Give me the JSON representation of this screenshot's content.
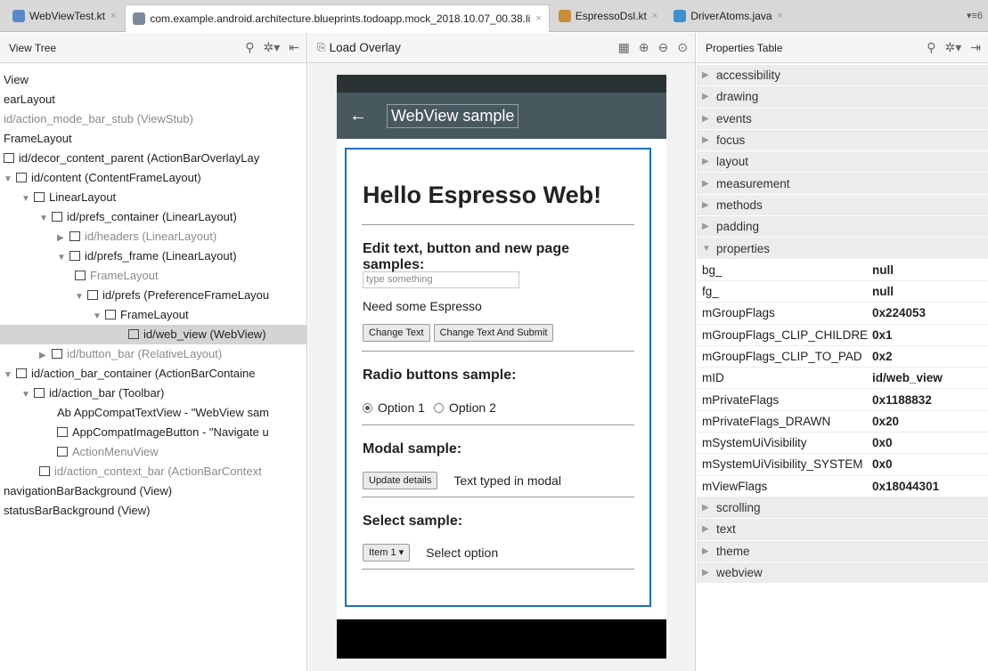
{
  "tabs": [
    {
      "label": "WebViewTest.kt",
      "icon": "kotlin-file-icon",
      "color": "#5b88c9",
      "active": false
    },
    {
      "label": "com.example.android.architecture.blueprints.todoapp.mock_2018.10.07_00.38.li",
      "icon": "layout-inspector-icon",
      "color": "#7c8a99",
      "active": true
    },
    {
      "label": "EspressoDsl.kt",
      "icon": "kotlin-file-icon",
      "color": "#c78c3c",
      "active": false
    },
    {
      "label": "DriverAtoms.java",
      "icon": "java-class-icon",
      "color": "#3f8fd0",
      "active": false
    }
  ],
  "tab_menu": "▾≡6",
  "view_tree": {
    "title": "View Tree",
    "rows": [
      {
        "text": "View",
        "dim": false,
        "arrow": "",
        "indent": 0,
        "icon": false
      },
      {
        "text": "earLayout",
        "dim": false,
        "arrow": "",
        "indent": 0,
        "icon": false
      },
      {
        "text": "id/action_mode_bar_stub (ViewStub)",
        "dim": true,
        "arrow": "",
        "indent": 0,
        "icon": false
      },
      {
        "text": "FrameLayout",
        "dim": false,
        "arrow": "",
        "indent": 0,
        "icon": false
      },
      {
        "text": "id/decor_content_parent (ActionBarOverlayLay",
        "dim": false,
        "arrow": "",
        "indent": 0,
        "icon": true
      },
      {
        "text": "id/content (ContentFrameLayout)",
        "dim": false,
        "arrow": "▼",
        "indent": 0,
        "icon": true
      },
      {
        "text": "LinearLayout",
        "dim": false,
        "arrow": "▼",
        "indent": 1,
        "icon": true
      },
      {
        "text": "id/prefs_container (LinearLayout)",
        "dim": false,
        "arrow": "▼",
        "indent": 2,
        "icon": true
      },
      {
        "text": "id/headers (LinearLayout)",
        "dim": true,
        "arrow": "▶",
        "indent": 3,
        "icon": true
      },
      {
        "text": "id/prefs_frame (LinearLayout)",
        "dim": false,
        "arrow": "▼",
        "indent": 3,
        "icon": true
      },
      {
        "text": "FrameLayout",
        "dim": true,
        "arrow": "",
        "indent": 4,
        "icon": true
      },
      {
        "text": "id/prefs (PreferenceFrameLayou",
        "dim": false,
        "arrow": "▼",
        "indent": 4,
        "icon": true
      },
      {
        "text": "FrameLayout",
        "dim": false,
        "arrow": "▼",
        "indent": 5,
        "icon": true
      },
      {
        "text": "id/web_view (WebView)",
        "dim": false,
        "arrow": "",
        "indent": 7,
        "icon": true,
        "selected": true
      },
      {
        "text": "id/button_bar (RelativeLayout)",
        "dim": true,
        "arrow": "▶",
        "indent": 2,
        "icon": true
      },
      {
        "text": "id/action_bar_container (ActionBarContaine",
        "dim": false,
        "arrow": "▼",
        "indent": 0,
        "icon": true
      },
      {
        "text": "id/action_bar (Toolbar)",
        "dim": false,
        "arrow": "▼",
        "indent": 1,
        "icon": true
      },
      {
        "text": "Ab AppCompatTextView - \"WebView sam",
        "dim": false,
        "arrow": "",
        "indent": 3,
        "icon": false
      },
      {
        "text": "AppCompatImageButton - \"Navigate u",
        "dim": false,
        "arrow": "",
        "indent": 3,
        "icon": true
      },
      {
        "text": "ActionMenuView",
        "dim": true,
        "arrow": "",
        "indent": 3,
        "icon": true
      },
      {
        "text": "id/action_context_bar (ActionBarContext",
        "dim": true,
        "arrow": "",
        "indent": 2,
        "icon": true
      },
      {
        "text": "navigationBarBackground (View)",
        "dim": false,
        "arrow": "",
        "indent": 0,
        "icon": false
      },
      {
        "text": "statusBarBackground (View)",
        "dim": false,
        "arrow": "",
        "indent": 0,
        "icon": false
      }
    ]
  },
  "overlay": {
    "title": "Load Overlay",
    "app_bar_title": "WebView sample",
    "heading": "Hello Espresso Web!",
    "section_edit": "Edit text, button and new page samples:",
    "input_placeholder": "type something",
    "para": "Need some Espresso",
    "btn_change": "Change Text",
    "btn_submit": "Change Text And Submit",
    "section_radio": "Radio buttons sample:",
    "opt1": "Option 1",
    "opt2": "Option 2",
    "section_modal": "Modal sample:",
    "btn_update": "Update details",
    "modal_text": "Text typed in modal",
    "section_select": "Select sample:",
    "select_value": "Item 1",
    "select_label": "Select option"
  },
  "properties": {
    "title": "Properties Table",
    "rows": [
      {
        "type": "group",
        "label": "accessibility",
        "open": false
      },
      {
        "type": "group",
        "label": "drawing",
        "open": false
      },
      {
        "type": "group",
        "label": "events",
        "open": false
      },
      {
        "type": "group",
        "label": "focus",
        "open": false
      },
      {
        "type": "group",
        "label": "layout",
        "open": false
      },
      {
        "type": "group",
        "label": "measurement",
        "open": false
      },
      {
        "type": "group",
        "label": "methods",
        "open": false
      },
      {
        "type": "group",
        "label": "padding",
        "open": false
      },
      {
        "type": "group",
        "label": "properties",
        "open": true
      },
      {
        "type": "kv",
        "key": "bg_",
        "value": "null"
      },
      {
        "type": "kv",
        "key": "fg_",
        "value": "null"
      },
      {
        "type": "kv",
        "key": "mGroupFlags",
        "value": "0x224053"
      },
      {
        "type": "kv",
        "key": "mGroupFlags_CLIP_CHILDRE",
        "value": "0x1"
      },
      {
        "type": "kv",
        "key": "mGroupFlags_CLIP_TO_PAD",
        "value": "0x2"
      },
      {
        "type": "kv",
        "key": "mID",
        "value": "id/web_view"
      },
      {
        "type": "kv",
        "key": "mPrivateFlags",
        "value": "0x1188832"
      },
      {
        "type": "kv",
        "key": "mPrivateFlags_DRAWN",
        "value": "0x20"
      },
      {
        "type": "kv",
        "key": "mSystemUiVisibility",
        "value": "0x0"
      },
      {
        "type": "kv",
        "key": "mSystemUiVisibility_SYSTEM",
        "value": "0x0"
      },
      {
        "type": "kv",
        "key": "mViewFlags",
        "value": "0x18044301"
      },
      {
        "type": "group",
        "label": "scrolling",
        "open": false
      },
      {
        "type": "group",
        "label": "text",
        "open": false
      },
      {
        "type": "group",
        "label": "theme",
        "open": false
      },
      {
        "type": "group",
        "label": "webview",
        "open": false
      }
    ]
  }
}
